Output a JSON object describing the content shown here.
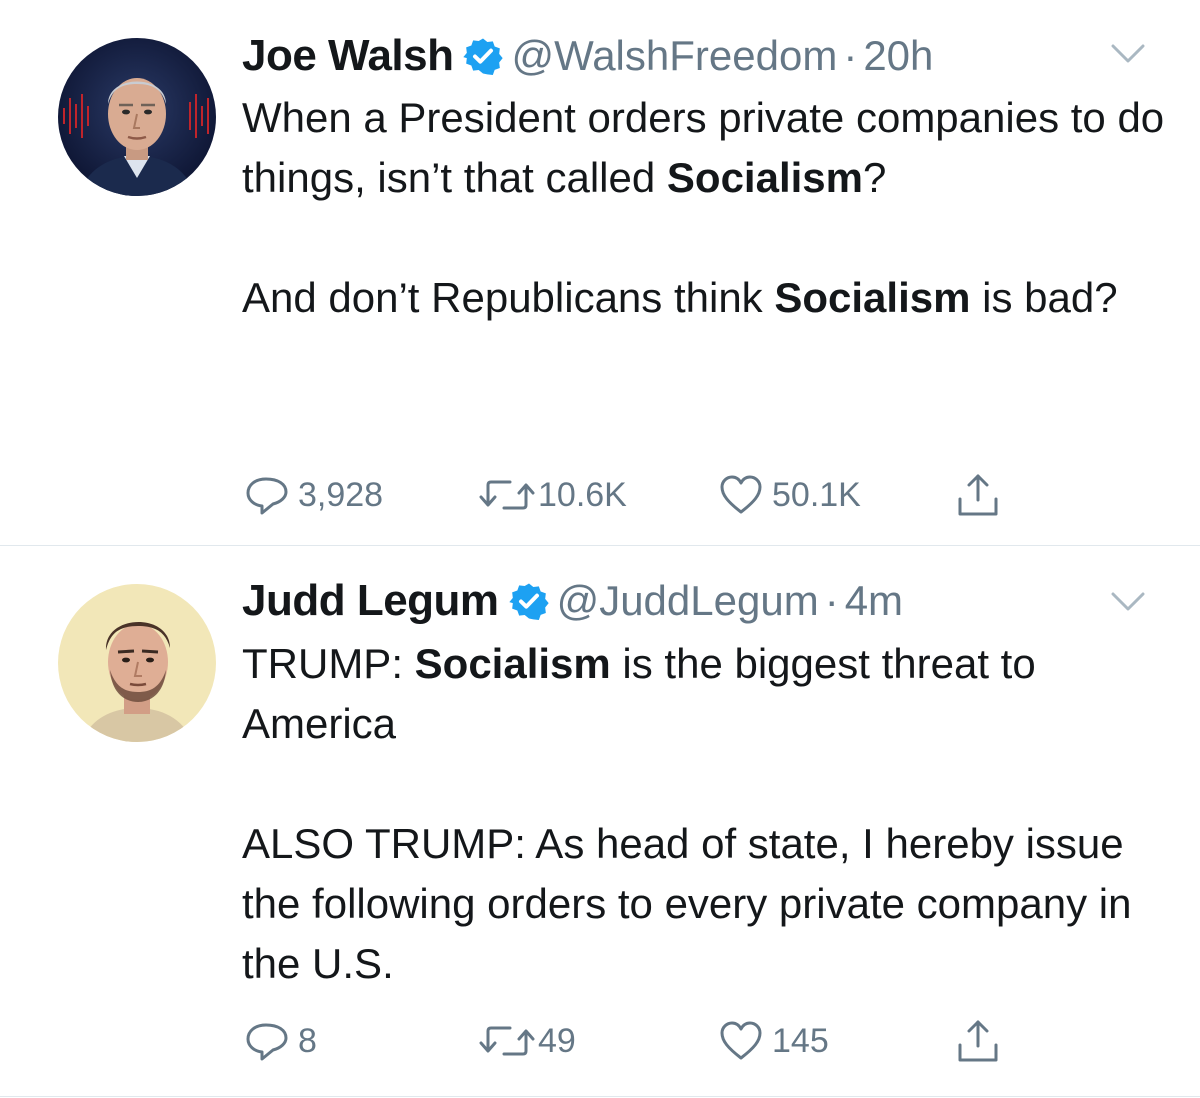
{
  "tweets": [
    {
      "author_name": "Joe Walsh",
      "handle": "@WalshFreedom",
      "separator": "·",
      "time": "20h",
      "paragraph1": [
        {
          "text": "When a President orders private companies to do things, isn’t that called ",
          "bold": false
        },
        {
          "text": "Socialism",
          "bold": true
        },
        {
          "text": "?",
          "bold": false
        }
      ],
      "paragraph2": [
        {
          "text": "And don’t Republicans think ",
          "bold": false
        },
        {
          "text": "Socialism",
          "bold": true
        },
        {
          "text": " is bad?",
          "bold": false
        }
      ],
      "replies": "3,928",
      "retweets": "10.6K",
      "likes": "50.1K",
      "avatar": "man-gray-hair-portrait"
    },
    {
      "author_name": "Judd Legum",
      "handle": "@JuddLegum",
      "separator": "·",
      "time": "4m",
      "paragraph1": [
        {
          "text": "TRUMP: ",
          "bold": false
        },
        {
          "text": "Socialism",
          "bold": true
        },
        {
          "text": " is the biggest threat to America",
          "bold": false
        }
      ],
      "paragraph2": [
        {
          "text": "ALSO TRUMP: As head of state, I hereby issue the following orders to every private company in the U.S.",
          "bold": false
        }
      ],
      "replies": "8",
      "retweets": "49",
      "likes": "145",
      "avatar": "man-dark-hair-portrait"
    }
  ],
  "colors": {
    "text": "#14171a",
    "secondary": "#657786",
    "verified": "#1da1f2",
    "divider": "#e1e8ed"
  },
  "icons": [
    "verified-badge-icon",
    "chevron-down-icon",
    "reply-icon",
    "retweet-icon",
    "like-icon",
    "share-icon"
  ]
}
